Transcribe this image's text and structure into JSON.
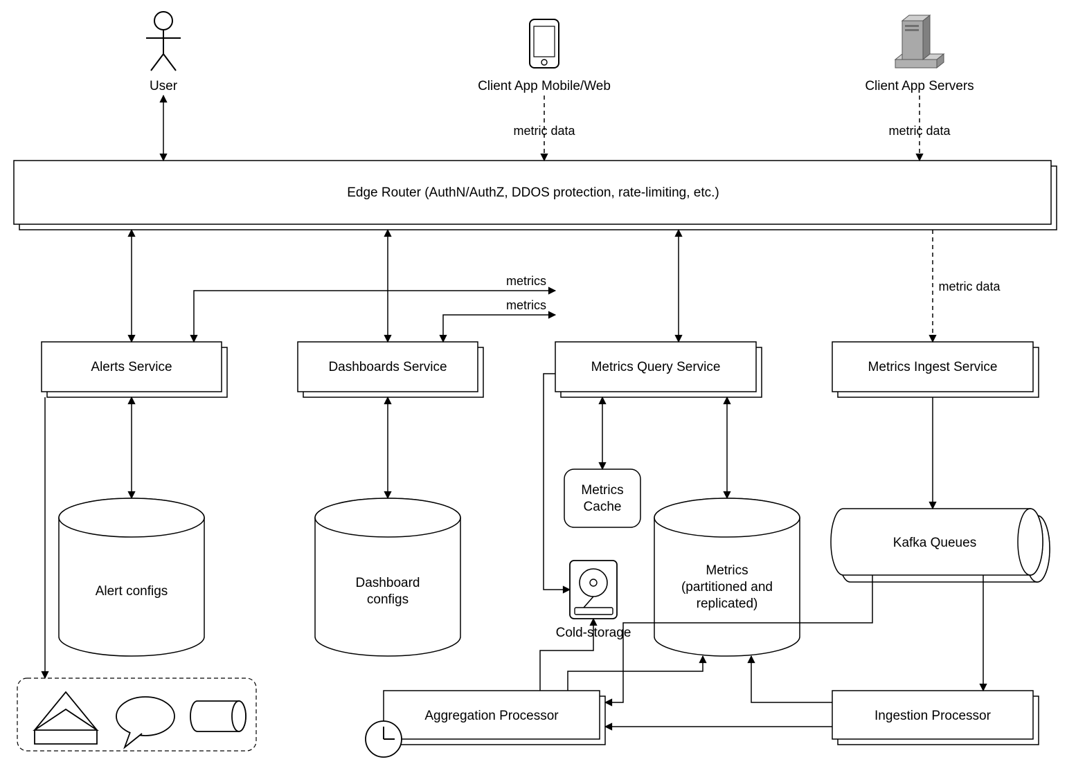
{
  "nodes": {
    "user": "User",
    "clientMobile": "Client App Mobile/Web",
    "clientServers": "Client App Servers",
    "edgeRouter": "Edge Router (AuthN/AuthZ, DDOS protection, rate-limiting, etc.)",
    "alertsService": "Alerts Service",
    "dashboardsService": "Dashboards Service",
    "metricsQueryService": "Metrics Query Service",
    "metricsIngestService": "Metrics Ingest Service",
    "alertConfigs": "Alert configs",
    "dashboardConfigs": "Dashboard configs",
    "metricsCache": "Metrics\nCache",
    "metricsDb": "Metrics\n(partitioned and\nreplicated)",
    "coldStorage": "Cold-storage",
    "kafka": "Kafka Queues",
    "aggregationProcessor": "Aggregation Processor",
    "ingestionProcessor": "Ingestion Processor"
  },
  "edgeLabels": {
    "metricData1": "metric data",
    "metricData2": "metric data",
    "metricData3": "metric data",
    "metrics1": "metrics",
    "metrics2": "metrics"
  }
}
